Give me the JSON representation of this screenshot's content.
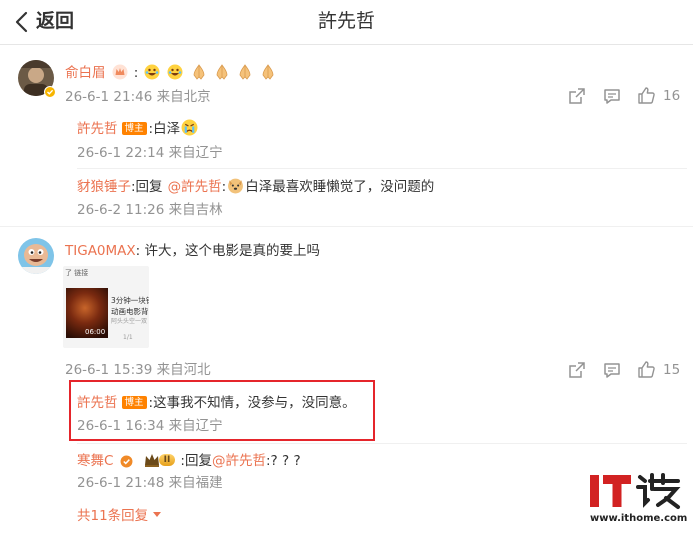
{
  "header": {
    "back_label": "返回",
    "title": "許先哲"
  },
  "comment1": {
    "username": "俞白眉",
    "content_colon": ":",
    "meta": "26-6-1 21:46 来自北京",
    "like_count": "16",
    "replies": [
      {
        "username": "許先哲",
        "badge": "博主",
        "content": ":白泽",
        "meta": "26-6-1 22:14 来自辽宁"
      },
      {
        "username": "豺狼锤子",
        "content_prefix": ":回复",
        "mention": "@許先哲",
        "content_suffix": ":",
        "content_tail": "白泽最喜欢睡懒觉了，没问题的",
        "meta": "26-6-2 11:26 来自吉林"
      }
    ]
  },
  "comment2": {
    "username": "TIGA0MAX",
    "content": ": 许大，这个电影是真的要上吗",
    "media": {
      "top_text": "了 链接",
      "line1": "3分钟一块钱",
      "line2": "动画电影背",
      "line3": "阿头头空一双",
      "duration": "06:00",
      "page": "1/1"
    },
    "meta": "26-6-1 15:39 来自河北",
    "like_count": "15",
    "replies": [
      {
        "username": "許先哲",
        "badge": "博主",
        "content": ":这事我不知情，没参与，没同意。",
        "meta": "26-6-1 16:34 来自辽宁"
      },
      {
        "username": "寒舞C",
        "level": "II",
        "content_prefix": ":回复",
        "mention": "@許先哲",
        "content_suffix": ":? ? ?",
        "meta": "26-6-1 21:48 来自福建"
      }
    ],
    "more_replies": "共11条回复"
  },
  "watermark": {
    "brand": "IT之家",
    "url": "www.ithome.com"
  },
  "colors": {
    "username": "#eb7350",
    "meta": "#939393",
    "badge": "#ff8200",
    "highlight": "#e5252b",
    "brand_red": "#d22222"
  }
}
